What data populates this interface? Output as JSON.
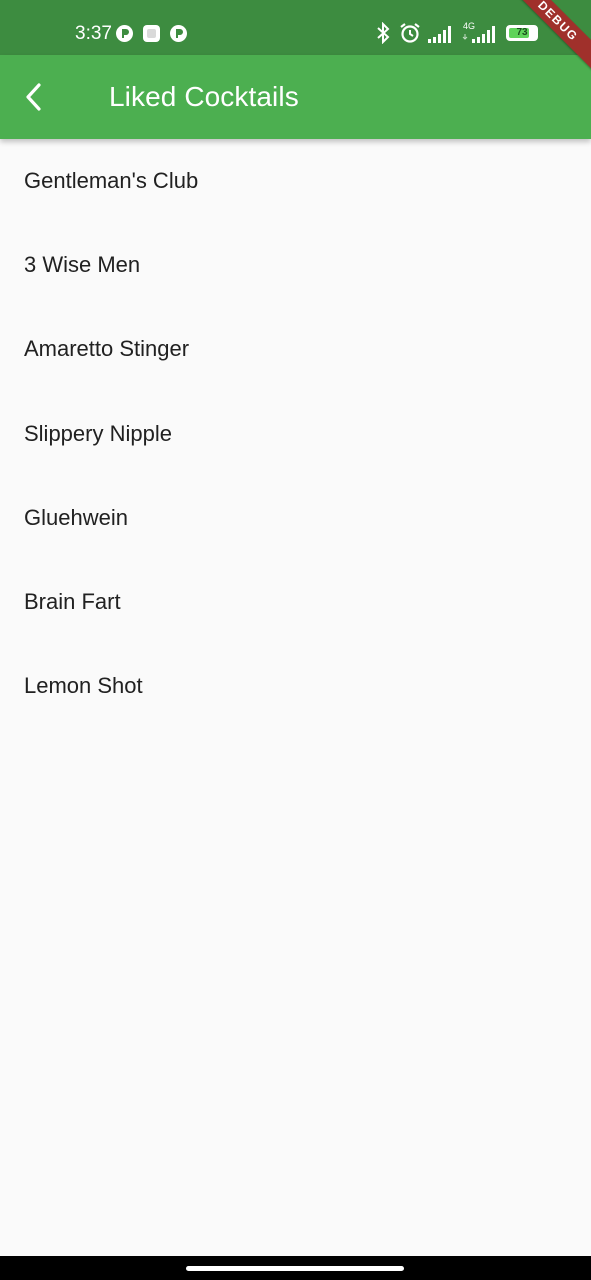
{
  "status_bar": {
    "time": "3:37",
    "network_label": "4G",
    "battery_level": "73",
    "battery_percent": 73
  },
  "app_bar": {
    "title": "Liked Cocktails",
    "background_color": "#4caf50"
  },
  "cocktails": [
    {
      "name": "Gentleman's Club"
    },
    {
      "name": "3 Wise Men"
    },
    {
      "name": "Amaretto Stinger"
    },
    {
      "name": "Slippery Nipple"
    },
    {
      "name": "Gluehwein"
    },
    {
      "name": "Brain Fart"
    },
    {
      "name": "Lemon Shot"
    }
  ],
  "debug_banner": "DEBUG",
  "icons": {
    "back": "arrow-back-icon",
    "bluetooth": "bluetooth-icon",
    "alarm": "alarm-icon",
    "signal": "signal-icon",
    "battery": "battery-icon"
  }
}
